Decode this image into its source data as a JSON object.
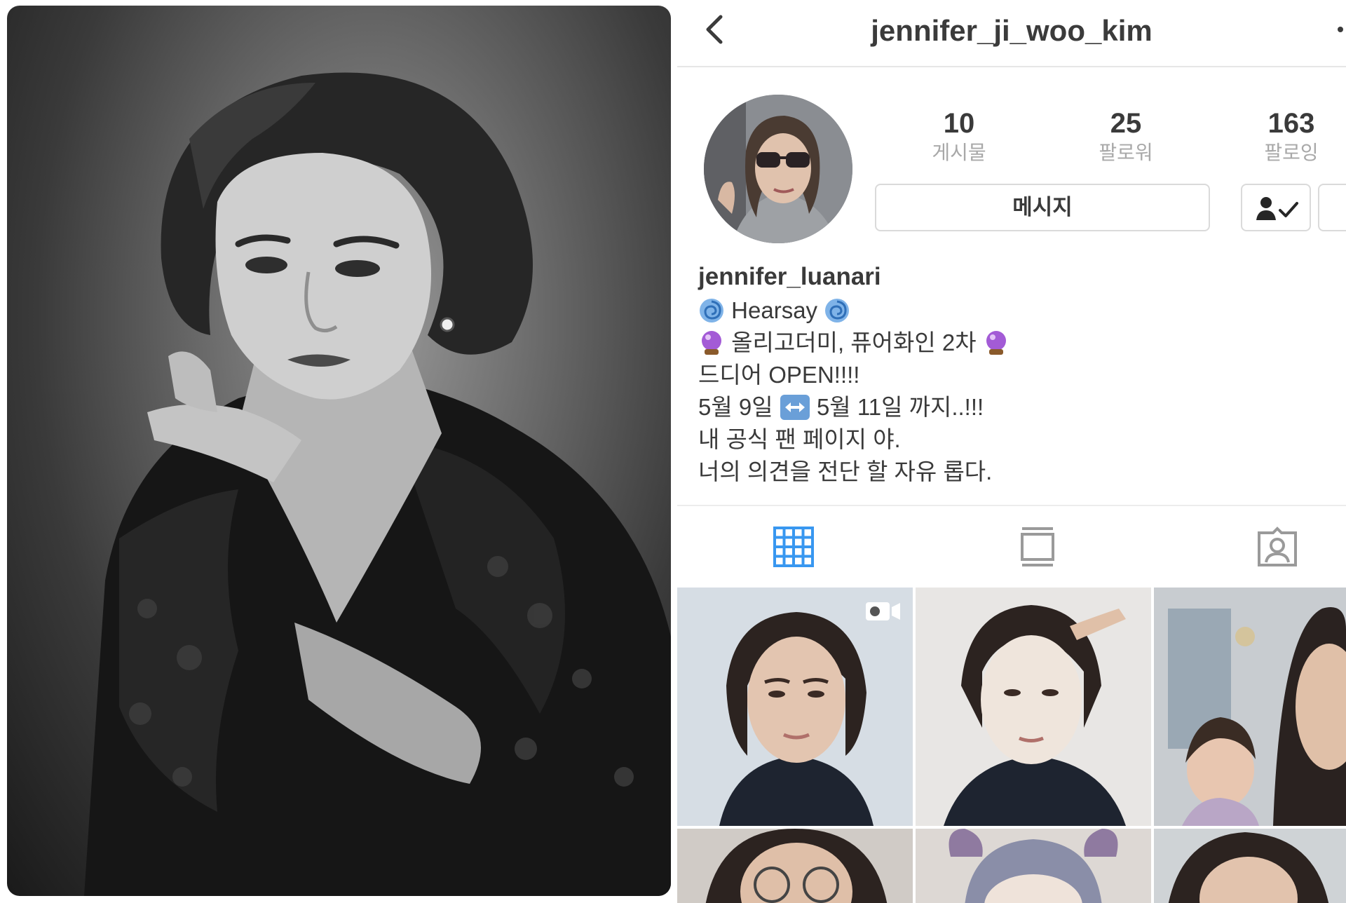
{
  "header": {
    "username": "jennifer_ji_woo_kim"
  },
  "profile": {
    "stats": [
      {
        "value": "10",
        "label": "게시물"
      },
      {
        "value": "25",
        "label": "팔로워"
      },
      {
        "value": "163",
        "label": "팔로잉"
      }
    ],
    "message_button": "메시지",
    "bio": {
      "name": "jennifer_luanari",
      "line1": "Hearsay",
      "line2": "올리고더미, 퓨어화인 2차",
      "line3": "드디어 OPEN!!!!",
      "line4a": "5월 9일",
      "line4b": "5월 11일 까지..!!!",
      "line5": "내 공식 팬 페이지 야.",
      "line6": "너의 의견을 전단 할 자유 롭다."
    }
  },
  "colors": {
    "accent": "#3897f0",
    "text": "#3a3a3a",
    "muted": "#a8a8a8",
    "border": "#dadada"
  },
  "icons": [
    "back-chevron-icon",
    "more-dot-icon",
    "following-person-check-icon",
    "cyclone-emoji-icon",
    "crystal-ball-emoji-icon",
    "left-right-arrow-emoji-icon",
    "grid-icon",
    "feed-icon",
    "tagged-icon",
    "video-camera-icon"
  ]
}
